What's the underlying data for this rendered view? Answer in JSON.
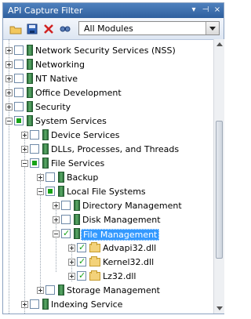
{
  "window": {
    "title": "API Capture Filter"
  },
  "titlebar": {
    "dropdown_glyph": "▾",
    "pin_glyph": "⊣",
    "close_glyph": "×"
  },
  "toolbar": {
    "module_select": "All Modules",
    "icons": [
      "open-folder-icon",
      "save-icon",
      "delete-icon",
      "find-icon"
    ]
  },
  "tree": {
    "items": [
      {
        "label": "Network Security Services (NSS)",
        "expander": "plus",
        "check": "none",
        "icon": "module"
      },
      {
        "label": "Networking",
        "expander": "plus",
        "check": "none",
        "icon": "module"
      },
      {
        "label": "NT Native",
        "expander": "plus",
        "check": "none",
        "icon": "module"
      },
      {
        "label": "Office Development",
        "expander": "plus",
        "check": "none",
        "icon": "module"
      },
      {
        "label": "Security",
        "expander": "plus",
        "check": "none",
        "icon": "module"
      },
      {
        "label": "System Services",
        "expander": "minus",
        "check": "partial",
        "icon": "module"
      },
      {
        "label": "Device Services",
        "expander": "plus",
        "check": "none",
        "icon": "module"
      },
      {
        "label": "DLLs, Processes, and Threads",
        "expander": "plus",
        "check": "none",
        "icon": "module"
      },
      {
        "label": "File Services",
        "expander": "minus",
        "check": "partial",
        "icon": "module"
      },
      {
        "label": "Backup",
        "expander": "plus",
        "check": "none",
        "icon": "module"
      },
      {
        "label": "Local File Systems",
        "expander": "minus",
        "check": "partial",
        "icon": "module"
      },
      {
        "label": "Directory Management",
        "expander": "plus",
        "check": "none",
        "icon": "module"
      },
      {
        "label": "Disk Management",
        "expander": "plus",
        "check": "none",
        "icon": "module"
      },
      {
        "label": "File Management",
        "expander": "minus",
        "check": "checked",
        "icon": "module",
        "selected": true
      },
      {
        "label": "Advapi32.dll",
        "expander": "plus",
        "check": "checked",
        "icon": "folder"
      },
      {
        "label": "Kernel32.dll",
        "expander": "plus",
        "check": "checked",
        "icon": "folder"
      },
      {
        "label": "Lz32.dll",
        "expander": "plus",
        "check": "checked",
        "icon": "folder"
      },
      {
        "label": "Storage Management",
        "expander": "plus",
        "check": "none",
        "icon": "module"
      },
      {
        "label": "Indexing Service",
        "expander": "plus",
        "check": "none",
        "icon": "module"
      }
    ]
  }
}
